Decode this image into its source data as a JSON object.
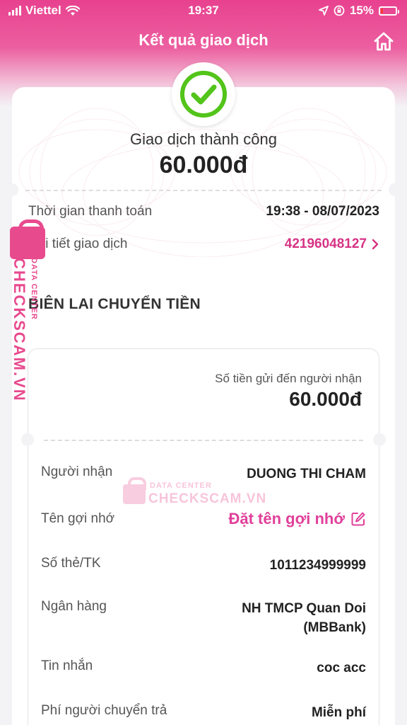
{
  "status_bar": {
    "carrier": "Viettel",
    "time": "19:37",
    "battery": "15%",
    "battery_level": 0.15
  },
  "header": {
    "title": "Kết quả giao dịch",
    "home_icon": "home-icon"
  },
  "result": {
    "status": "Giao dịch thành công",
    "amount": "60.000đ",
    "icon": "check-circle-icon",
    "success_color": "#52c41a"
  },
  "info": {
    "time_label": "Thời gian thanh toán",
    "time_value": "19:38 - 08/07/2023",
    "detail_label": "Chi tiết giao dịch",
    "detail_value": "42196048127"
  },
  "receipt": {
    "title": "BIÊN LAI CHUYỂN TIỀN",
    "sent_label": "Số tiền gửi đến người nhận",
    "sent_amount": "60.000đ",
    "rows": [
      {
        "label": "Người nhận",
        "value": "DUONG THI CHAM"
      },
      {
        "label": "Tên gợi nhớ",
        "value": "Đặt tên gợi nhớ"
      },
      {
        "label": "Số thẻ/TK",
        "value": "1011234999999"
      },
      {
        "label": "Ngân hàng",
        "value": "NH TMCP Quan Doi",
        "value2": "(MBBank)"
      },
      {
        "label": "Tin nhắn",
        "value": "coc acc"
      },
      {
        "label": "Phí người chuyển trả",
        "value": "Miễn phí"
      }
    ]
  },
  "watermark": {
    "big": "CHECKSCAM.VN",
    "small": "DATA CENTER"
  },
  "colors": {
    "brand_pink": "#e8418f",
    "link_pink": "#d63384",
    "nickname_pink": "#e0409a"
  }
}
